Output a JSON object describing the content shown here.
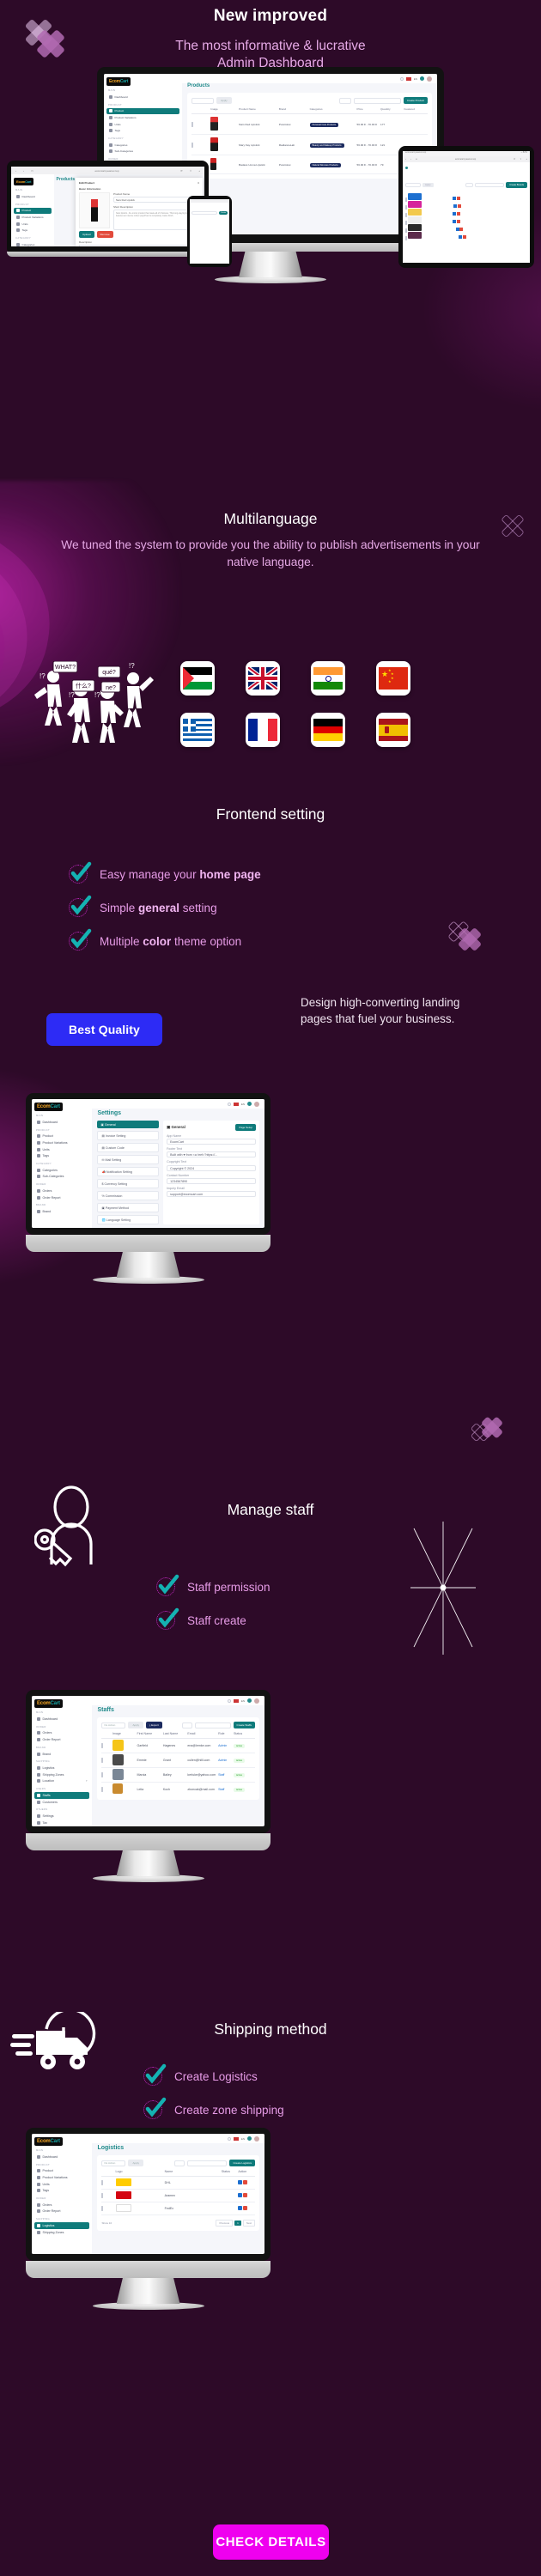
{
  "theme": {
    "bg": "#2d0a28",
    "accent_pink": "#e6a9e6",
    "accent_magenta": "#ef00ef",
    "accent_blue": "#2d2bf5",
    "accent_teal": "#0f9f9f"
  },
  "hero": {
    "eyebrow": "New improved",
    "subtitle_line1": "The most informative & lucrative",
    "subtitle_line2": "Admin Dashboard"
  },
  "multilanguage": {
    "title": "Multilanguage",
    "description": "We tuned the system to provide you the ability to publish advertisements in your native language.",
    "flags": [
      {
        "name": "palestine-flag",
        "label": "Palestine"
      },
      {
        "name": "united-kingdom-flag",
        "label": "United Kingdom"
      },
      {
        "name": "india-flag",
        "label": "India"
      },
      {
        "name": "china-flag",
        "label": "China"
      },
      {
        "name": "greece-flag",
        "label": "Greece"
      },
      {
        "name": "france-flag",
        "label": "France"
      },
      {
        "name": "germany-flag",
        "label": "Germany"
      },
      {
        "name": "spain-flag",
        "label": "Spain"
      }
    ]
  },
  "frontend_setting": {
    "title": "Frontend setting",
    "features": [
      {
        "prefix": "Easy manage your ",
        "bold": "home page",
        "suffix": ""
      },
      {
        "prefix": "Simple ",
        "bold": "general",
        "suffix": " setting"
      },
      {
        "prefix": "Multiple ",
        "bold": "color",
        "suffix": " theme option"
      }
    ],
    "badge_label": "Best Quality",
    "blurb": "Design high-converting landing pages that fuel your business."
  },
  "settings_screen": {
    "page_title": "Settings",
    "brand": {
      "part1": "Ecom",
      "part2": "Cart"
    },
    "sidebar": [
      {
        "type": "caption",
        "label": "MAIN"
      },
      {
        "type": "item",
        "label": "Dashboard",
        "active": false
      },
      {
        "type": "caption",
        "label": "PRODUCT"
      },
      {
        "type": "item",
        "label": "Product",
        "active": false
      },
      {
        "type": "item",
        "label": "Product Variations",
        "active": false
      },
      {
        "type": "item",
        "label": "Units",
        "active": false
      },
      {
        "type": "item",
        "label": "Tags",
        "active": false
      },
      {
        "type": "caption",
        "label": "CATEGORY"
      },
      {
        "type": "item",
        "label": "Categories",
        "active": false
      },
      {
        "type": "item",
        "label": "Sub-Categories",
        "active": false
      },
      {
        "type": "caption",
        "label": "ORDER"
      },
      {
        "type": "item",
        "label": "Orders",
        "active": false
      },
      {
        "type": "item",
        "label": "Order Report",
        "active": false
      },
      {
        "type": "caption",
        "label": "BRAND"
      },
      {
        "type": "item",
        "label": "Brand",
        "active": false
      }
    ],
    "tabs": [
      {
        "label": "General",
        "active": true
      },
      {
        "label": "Invoice Setting",
        "active": false
      },
      {
        "label": "Custom Code",
        "active": false
      },
      {
        "label": "Mail Setting",
        "active": false
      },
      {
        "label": "Notification Setting",
        "active": false
      },
      {
        "label": "Currency Setting",
        "active": false
      },
      {
        "label": "Commission",
        "active": false
      },
      {
        "label": "Payment Method",
        "active": false
      },
      {
        "label": "Language Setting",
        "active": false
      }
    ],
    "panel_title": "General",
    "save_label": "Page Setup",
    "fields": [
      {
        "label": "App Name",
        "value": "EcomCart"
      },
      {
        "label": "Footer Text",
        "value": "Built with ♥ from <a href=\"https://..."
      },
      {
        "label": "Copyright Text",
        "value": "Copyright © 2024"
      },
      {
        "label": "Contact Number",
        "value": "1234567890"
      },
      {
        "label": "Inquiry Email",
        "value": "support@ecomcart.com"
      }
    ]
  },
  "manage_staff": {
    "title": "Manage staff",
    "features": [
      "Staff permission",
      "Staff create"
    ]
  },
  "staffs_screen": {
    "page_title": "Staffs",
    "toolbar": {
      "action_select": "No Action",
      "apply_label": "Apply",
      "export_label": "Export",
      "search_placeholder": "Search...",
      "per_page": "10",
      "create_label": "Create Staffs"
    },
    "columns": [
      "Image",
      "First Name",
      "Last Name",
      "Email",
      "Role",
      "Status",
      "Action"
    ],
    "rows": [
      {
        "first_name": "Garfield",
        "last_name": "Hagenes",
        "email": "ena@lemke.com",
        "role": "Admin",
        "status": "Active"
      },
      {
        "first_name": "Emmie",
        "last_name": "Grant",
        "email": "cullen@hilll.com",
        "role": "Admin",
        "status": "Active"
      },
      {
        "first_name": "Marcia",
        "last_name": "Bailey",
        "email": "kerluke@yahoo.com",
        "role": "Staff",
        "status": "Active"
      }
    ],
    "sidebar": [
      {
        "type": "caption",
        "label": "MAIN"
      },
      {
        "type": "item",
        "label": "Dashboard",
        "active": false
      },
      {
        "type": "caption",
        "label": "ORDER"
      },
      {
        "type": "item",
        "label": "Orders",
        "active": false
      },
      {
        "type": "item",
        "label": "Order Report",
        "active": false
      },
      {
        "type": "caption",
        "label": "BRAND"
      },
      {
        "type": "item",
        "label": "Brand",
        "active": false
      },
      {
        "type": "caption",
        "label": "SHIPPING"
      },
      {
        "type": "item",
        "label": "Logistics",
        "active": false
      },
      {
        "type": "item",
        "label": "Shipping Zones",
        "active": false
      },
      {
        "type": "item",
        "label": "Location",
        "active": false
      },
      {
        "type": "caption",
        "label": "USERS"
      },
      {
        "type": "item",
        "label": "Staffs",
        "active": true
      },
      {
        "type": "item",
        "label": "Customers",
        "active": false
      },
      {
        "type": "caption",
        "label": "OTHERS"
      },
      {
        "type": "item",
        "label": "Settings",
        "active": false
      },
      {
        "type": "item",
        "label": "Tax",
        "active": false
      }
    ]
  },
  "shipping_method": {
    "title": "Shipping method",
    "features": [
      "Create Logistics",
      "Create zone shipping"
    ]
  },
  "logistics_screen": {
    "page_title": "Logistics",
    "toolbar": {
      "action_select": "No Action",
      "apply_label": "Apply",
      "per_page": "10",
      "search_placeholder": "Search...",
      "create_label": "Create Logistics"
    },
    "columns": [
      "Logo",
      "Name",
      "Status",
      "Action"
    ],
    "rows": [
      {
        "name": "DHL",
        "status": "Active"
      },
      {
        "name": "Aramex",
        "status": "Active"
      },
      {
        "name": "FedEx",
        "status": "Active"
      }
    ],
    "footer": {
      "previous": "Previous",
      "next": "Next",
      "page": "1"
    },
    "sidebar": [
      {
        "type": "caption",
        "label": "MAIN"
      },
      {
        "type": "item",
        "label": "Dashboard",
        "active": false
      },
      {
        "type": "caption",
        "label": "PRODUCT"
      },
      {
        "type": "item",
        "label": "Product",
        "active": false
      },
      {
        "type": "item",
        "label": "Product Variations",
        "active": false
      },
      {
        "type": "item",
        "label": "Units",
        "active": false
      },
      {
        "type": "item",
        "label": "Tags",
        "active": false
      },
      {
        "type": "caption",
        "label": "ORDER"
      },
      {
        "type": "item",
        "label": "Orders",
        "active": false
      },
      {
        "type": "item",
        "label": "Order Report",
        "active": false
      },
      {
        "type": "caption",
        "label": "SHIPPING"
      },
      {
        "type": "item",
        "label": "Logistics",
        "active": true
      },
      {
        "type": "item",
        "label": "Shipping Zones",
        "active": false
      }
    ]
  },
  "footer": {
    "cta_label": "CHECK DETAILS"
  },
  "hero_screens": {
    "products_title": "Products",
    "brands_title": "Brands",
    "edit_modal_title": "Edit Product",
    "basic_info": "Basic Information",
    "product_name_label": "Product Name",
    "product_name_value": "Nars Red Lipstick",
    "short_desc_label": "Short Description",
    "description_label": "Description",
    "upload_label": "Upload",
    "remove_label": "Remove",
    "columns": [
      "Image",
      "Product Name",
      "Brand",
      "Categories",
      "Price",
      "Quantity",
      "Featured",
      "Status"
    ],
    "rows": [
      {
        "name": "Nars Red Lipstick",
        "brand": "PureGlow",
        "category": "Personal Care Products",
        "price": "56.00 € - 70.00 €",
        "qty": "177"
      },
      {
        "name": "Mary Kay Lipstick",
        "brand": "RadianceLab",
        "category": "Beauty and Makeup Products",
        "price": "56.00 € - 70.00 €",
        "qty": "121"
      },
      {
        "name": "Badass Uoma Lipstick",
        "brand": "PureGlow",
        "category": "Natural Skincare Products",
        "price": "56.00 € - 70.00 €",
        "qty": "79"
      }
    ]
  }
}
